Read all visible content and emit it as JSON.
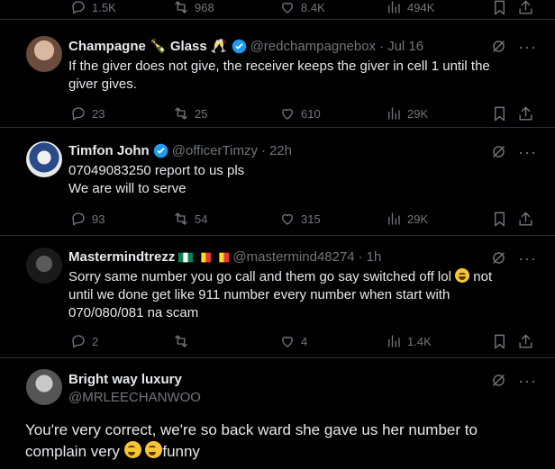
{
  "top_actions": {
    "replies": "1.5K",
    "reposts": "968",
    "likes": "8.4K",
    "views": "494K"
  },
  "tweets": [
    {
      "name": "Champagne 🍾 Glass 🥂",
      "handle": "@redchampagnebox",
      "time": "Jul 16",
      "text": "If the giver does not give, the receiver keeps the giver in cell 1 until the giver gives.",
      "replies": "23",
      "reposts": "25",
      "likes": "610",
      "views": "29K"
    },
    {
      "name": "Timfon John",
      "handle": "@officerTimzy",
      "time": "22h",
      "text_line1": "07049083250 report to us pls",
      "text_line2": "We are will to serve",
      "replies": "93",
      "reposts": "54",
      "likes": "315",
      "views": "29K"
    },
    {
      "name": "Mastermindtrezz",
      "handle": "@mastermind48274",
      "time": "1h",
      "text_a": "Sorry same number you go call and them go say switched off lol",
      "text_b": "not until we done get like 911 number every number when start with 070/080/081 na scam",
      "replies": "2",
      "reposts": "",
      "likes": "4",
      "views": "1.4K"
    }
  ],
  "focus": {
    "name": "Bright way luxury",
    "handle": "@MRLEECHANWOO",
    "text_a": "You're very correct, we're so back ward she gave us her number to complain very",
    "text_b": "funny"
  },
  "colors": {
    "background": "#000000",
    "muted": "#71767b",
    "text": "#e7e9ea",
    "verified": "#1d9bf0",
    "divider": "#2f3336"
  },
  "icons": [
    "reply-icon",
    "repost-icon",
    "like-icon",
    "views-icon",
    "bookmark-icon",
    "share-icon",
    "grok-icon",
    "more-icon",
    "verified-badge-icon"
  ]
}
